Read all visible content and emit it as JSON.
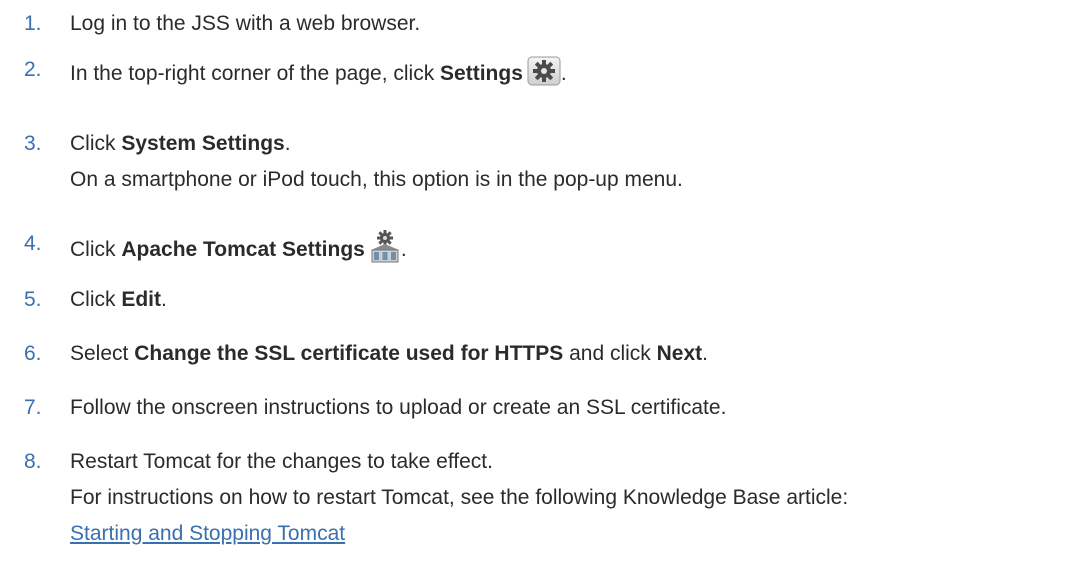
{
  "steps": [
    {
      "number": "1.",
      "text": "Log in to the JSS with a web browser."
    },
    {
      "number": "2.",
      "text_before": "In the top-right corner of the page, click ",
      "bold": "Settings",
      "text_after": ".",
      "icon": "gear-icon"
    },
    {
      "number": "3.",
      "text_before": "Click ",
      "bold": "System Settings",
      "text_after": ".",
      "note": "On a smartphone or iPod touch, this option is in the pop-up menu."
    },
    {
      "number": "4.",
      "text_before": "Click ",
      "bold": "Apache Tomcat Settings",
      "text_after": ".",
      "icon": "tomcat-server-icon"
    },
    {
      "number": "5.",
      "text_before": "Click ",
      "bold": "Edit",
      "text_after": "."
    },
    {
      "number": "6.",
      "text_before": "Select ",
      "bold": "Change the SSL certificate used for HTTPS",
      "text_middle": " and click ",
      "bold2": "Next",
      "text_after": "."
    },
    {
      "number": "7.",
      "text": "Follow the onscreen instructions to upload or create an SSL certificate."
    },
    {
      "number": "8.",
      "text": "Restart Tomcat for the changes to take effect.",
      "note": "For instructions on how to restart Tomcat, see the following Knowledge Base article:",
      "link": "Starting and Stopping Tomcat"
    }
  ],
  "colors": {
    "number": "#3a6fb0",
    "text": "#2b2b2b",
    "link": "#3a6fb0"
  }
}
